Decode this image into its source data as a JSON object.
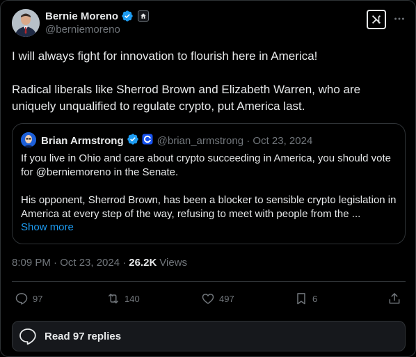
{
  "author": {
    "name": "Bernie Moreno",
    "handle": "@berniemoreno"
  },
  "tweet": {
    "text": "I will always fight for innovation to flourish here in America!\n\nRadical liberals like Sherrod Brown and Elizabeth Warren, who are uniquely unqualified to regulate crypto, put America last."
  },
  "quote": {
    "name": "Brian Armstrong",
    "meta": "@brian_armstrong · Oct 23, 2024",
    "text": "If you live in Ohio and care about crypto succeeding in America, you should vote for @berniemoreno in the Senate.\n\nHis opponent, Sherrod Brown, has been a blocker to sensible crypto legislation in America at every step of the way, refusing to meet with people from the ...",
    "show_more": "Show more"
  },
  "timestamp": "8:09 PM · Oct 23, 2024 ·",
  "views": {
    "count": "26.2K",
    "label": "Views"
  },
  "actions": {
    "replies": "97",
    "reposts": "140",
    "likes": "497",
    "bookmarks": "6"
  },
  "read_replies": "Read 97 replies",
  "colors": {
    "background": "#000000",
    "verified": "#1d9bf0",
    "link": "#1d9bf0",
    "muted": "#71767b",
    "border": "#2f3336"
  },
  "icons": [
    "verified-badge-icon",
    "affiliate-badge-icon",
    "grok-icon",
    "more-icon",
    "reply-icon",
    "repost-icon",
    "like-icon",
    "bookmark-icon",
    "share-icon",
    "chat-bubble-icon"
  ]
}
